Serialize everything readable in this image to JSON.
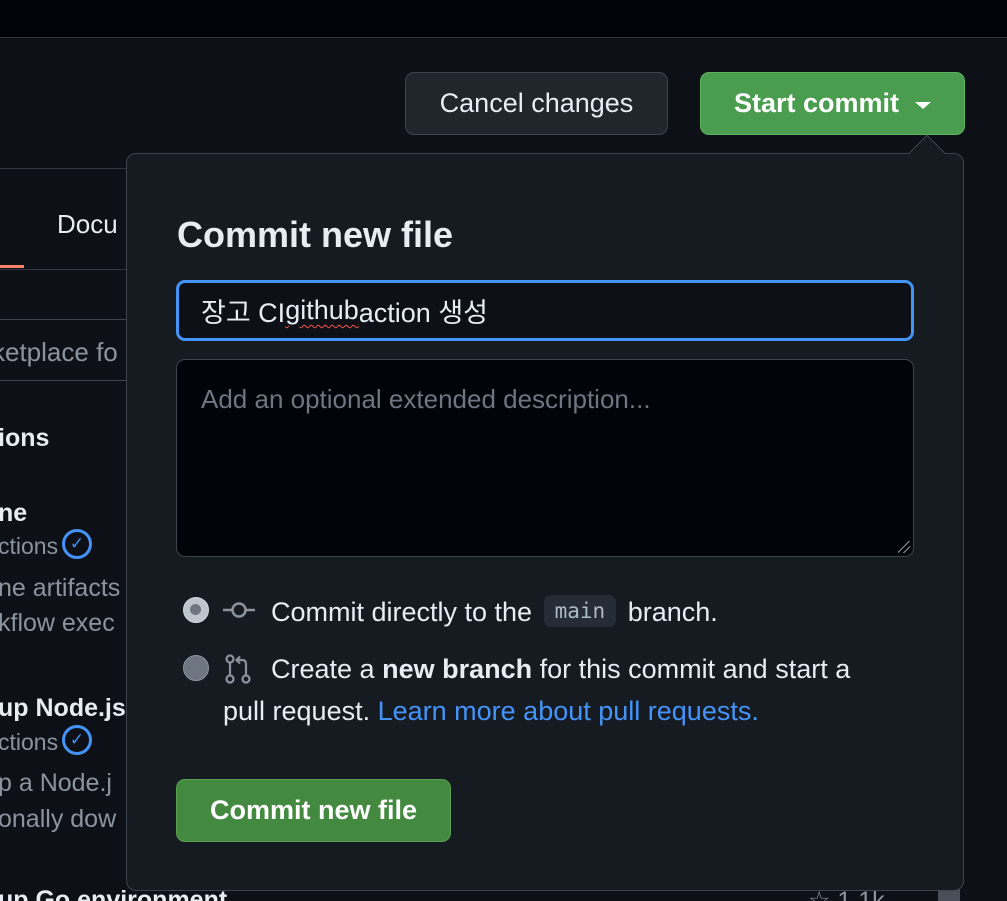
{
  "header": {
    "cancel_label": "Cancel changes",
    "start_commit_label": "Start commit"
  },
  "background": {
    "active_tab_fragment": "e",
    "docs_tab_fragment": "Docu",
    "search_fragment": "ketplace fo",
    "section_fragment": "ions",
    "items": [
      {
        "name_fragment": "ne",
        "publisher_fragment": "ctions",
        "desc_line1": "ne artifacts",
        "desc_line2": "kflow exec"
      },
      {
        "name_fragment": "up Node.js",
        "publisher_fragment": "ctions",
        "desc_line1": "p a Node.j",
        "desc_line2": "onally dow"
      }
    ],
    "peek_name_fragment": "up Go environment",
    "peek_stars_fragment": "1.1k"
  },
  "popover": {
    "title": "Commit new file",
    "summary_parts": [
      "장고 CI ",
      "github",
      " action 생성"
    ],
    "description_placeholder": "Add an optional extended description...",
    "option_direct": {
      "prefix": "Commit directly to the",
      "branch": "main",
      "suffix": "branch.",
      "selected": true,
      "icon": "git-commit-icon"
    },
    "option_new_branch": {
      "prefix": "Create a",
      "bold": "new branch",
      "suffix": "for this commit and start a",
      "line2": "pull request.",
      "link": "Learn more about pull requests.",
      "selected": false,
      "icon": "git-pull-request-icon"
    },
    "commit_button_label": "Commit new file"
  },
  "colors": {
    "accent_blue": "#4493f8",
    "green_button": "#4a9d4e",
    "background": "#0d1117",
    "popover_bg": "#161b22"
  }
}
